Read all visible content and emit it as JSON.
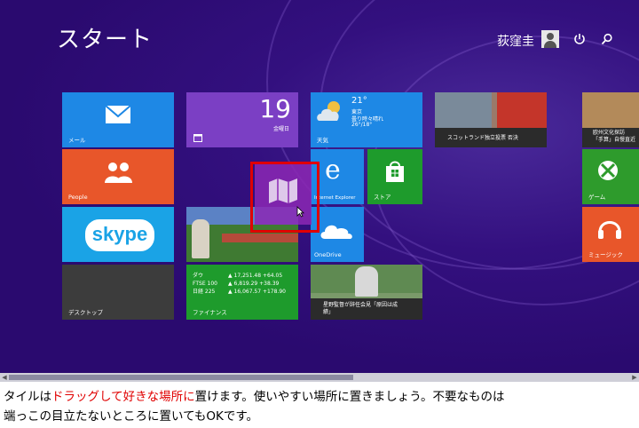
{
  "header": {
    "title": "スタート",
    "user_name": "荻窪圭"
  },
  "tiles": {
    "mail": "メール",
    "calendar_day": "19",
    "calendar_weekday": "金曜日",
    "weather": {
      "temp": "21°",
      "city": "東京",
      "condition": "曇り時々晴れ",
      "range": "26°/18°",
      "label": "天気"
    },
    "news1": "スコットランド独立投票 否決",
    "travel1": "欧州文化探訪",
    "travel2": "「手算」自慢直近",
    "people": "People",
    "ie": "Internet Explorer",
    "store": "ストア",
    "games": "ゲーム",
    "skype": "skype",
    "onedrive": "OneDrive",
    "music": "ミュージック",
    "finance": {
      "rows": [
        {
          "name": "ダウ",
          "value": "▲ 17,251.48 +64.05"
        },
        {
          "name": "FTSE 100",
          "value": "▲ 6,819.29 +38.39"
        },
        {
          "name": "日経 225",
          "value": "▲ 16,067.57 +178.90"
        }
      ],
      "label": "ファイナンス"
    },
    "desktop": "デスクトップ",
    "sports_line1": "星野監督が辞任会見「原因は成",
    "sports_line2": "績」"
  },
  "caption": {
    "part1": "タイルは",
    "highlight": "ドラッグして好きな場所に",
    "part2": "置けます。使いやすい場所に置きましょう。不要なものは",
    "line2": "端っこの目立たないところに置いてもOKです。"
  },
  "colors": {
    "background": "#2d0d73",
    "mail": "#1e88e5",
    "calendar": "#7b3fc4",
    "people": "#e8562a",
    "skype": "#1aa3e6",
    "desktop": "#3c3c3c",
    "finance": "#1e9b2c",
    "store": "#1e9b2c",
    "games": "#2e9b2c",
    "weather": "#1e88e5",
    "highlight_border": "#e00000"
  }
}
